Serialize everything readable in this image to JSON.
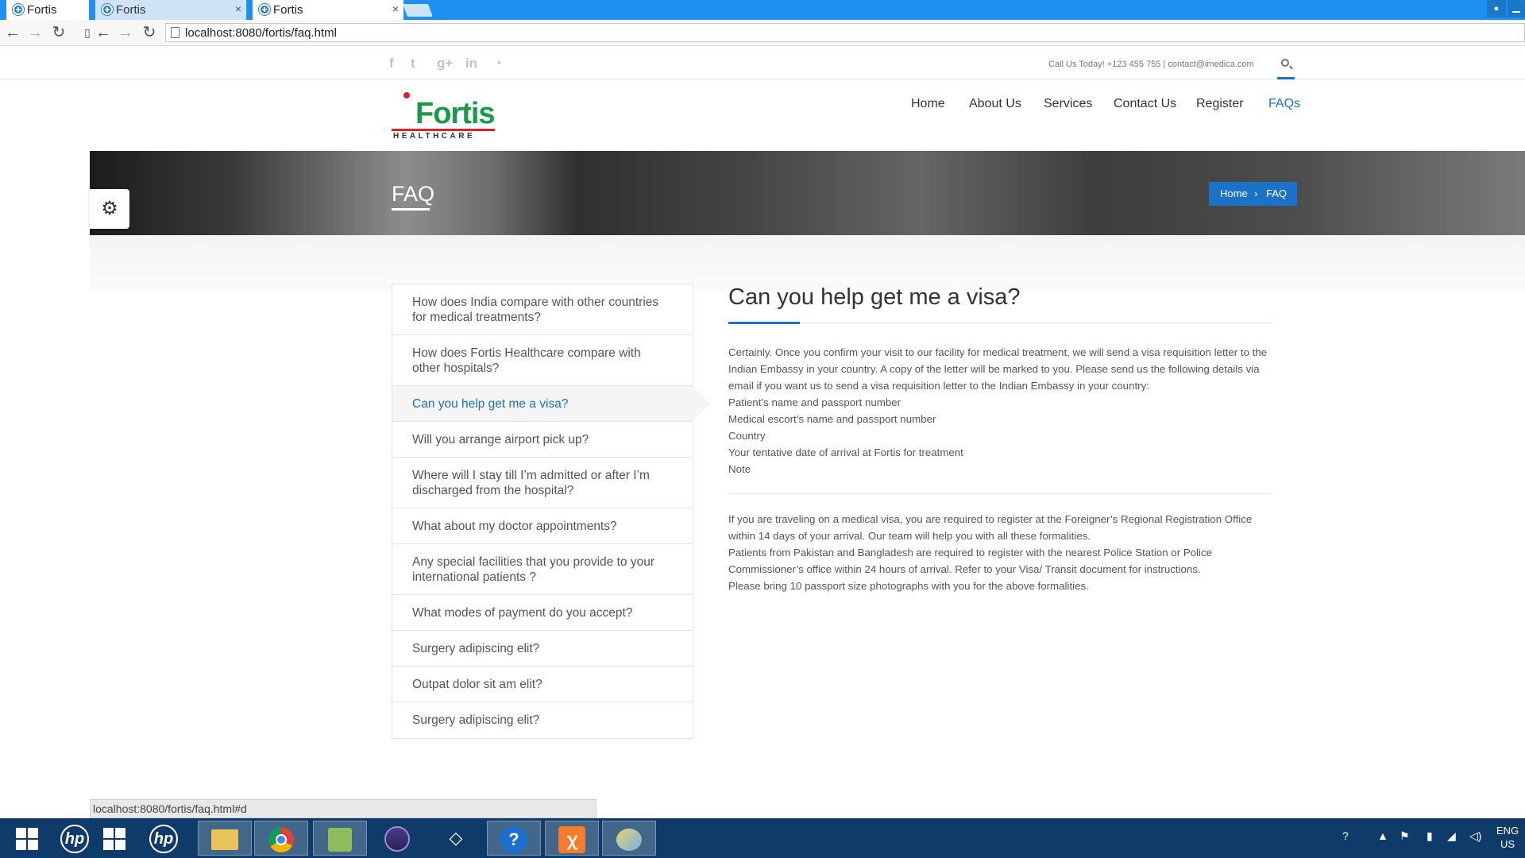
{
  "browser": {
    "tabs": [
      {
        "label": "Fortis",
        "state": "active"
      },
      {
        "label": "Fortis",
        "state": "inactive"
      },
      {
        "label": "Fortis",
        "state": "active"
      }
    ],
    "url": "localhost:8080/fortis/faq.html",
    "status_url": "localhost:8080/fortis/faq.html#d"
  },
  "topbar": {
    "social_icons": [
      "facebook-icon",
      "twitter-icon",
      "google-plus-icon",
      "linkedin-icon",
      "rss-icon"
    ],
    "contact": "Call Us Today! +123 455 755 | contact@imedica.com"
  },
  "logo": {
    "word": "Fortis",
    "sub": "HEALTHCARE"
  },
  "nav": {
    "home": "Home",
    "about": "About Us",
    "services": "Services",
    "contact": "Contact Us",
    "register": "Register",
    "faqs": "FAQs"
  },
  "banner": {
    "title": "FAQ",
    "crumb_home": "Home",
    "crumb_sep": "›",
    "crumb_current": "FAQ"
  },
  "faq": {
    "questions": [
      "How does India compare with other countries for medical treatments?",
      "How does Fortis Healthcare compare with other hospitals?",
      "Can you help get me a visa?",
      "Will you arrange airport pick up?",
      "Where will I stay till I’m admitted or after I’m discharged from the hospital?",
      "What about my doctor appointments?",
      "Any special facilities that you provide to your international patients ?",
      "What modes of payment do you accept?",
      "Surgery adipiscing elit?",
      "Outpat dolor sit am elit?",
      "Surgery adipiscing elit?"
    ],
    "active_index": 2
  },
  "answer": {
    "title": "Can you help get me a visa?",
    "paragraph": "Certainly. Once you confirm your visit to our facility for medical treatment, we will send a visa requisition letter to the Indian Embassy in your country. A copy of the letter will be marked to you. Please send us the following details via email if you want us to send a visa requisition letter to the Indian Embassy in your country:",
    "list": [
      " Patient’s name and passport number",
      " Medical escort’s name and passport number",
      " Country",
      " Your tentative date of arrival at Fortis for treatment"
    ],
    "note": "Note",
    "notes": [
      " If you are traveling on a medical visa, you are required to register at the Foreigner’s Regional Registration Office within 14 days of your arrival. Our team will help you with all these formalities.",
      " Patients from Pakistan and Bangladesh are required to register with the nearest Police Station or Police Commissioner’s office within 24 hours of arrival. Refer to your Visa/ Transit document for instructions.",
      " Please bring 10 passport size photographs with you for the above formalities."
    ]
  },
  "taskbar": {
    "apps": [
      "windows-start",
      "hp-app",
      "windows-app",
      "hp-app-2",
      "file-explorer",
      "chrome",
      "task-app",
      "eclipse",
      "unity",
      "help",
      "xampp",
      "paint"
    ],
    "language": "ENG",
    "region": "US"
  },
  "colors": {
    "accent": "#1a73c7",
    "tabstrip": "#1e90f0",
    "taskbar": "#0f3b6b"
  }
}
